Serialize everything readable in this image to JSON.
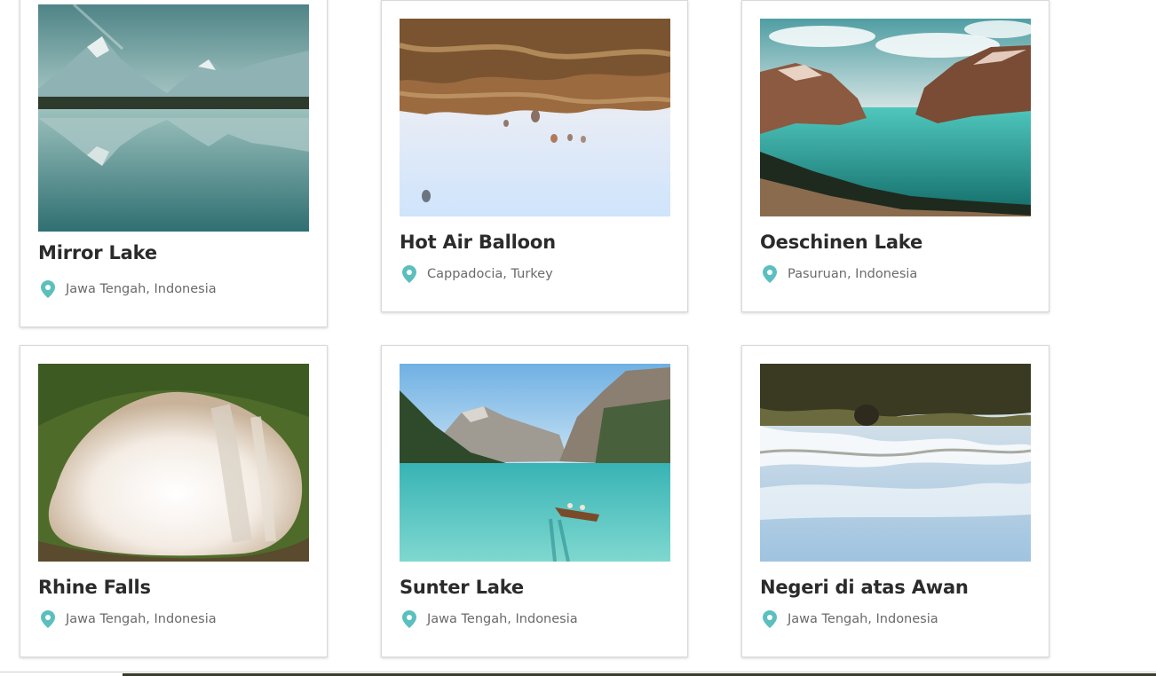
{
  "theme": {
    "pin_color": "#5bbfbf",
    "title_color": "#2b2b2b",
    "location_color": "#6a6a6a",
    "card_border": "#d9d9d9"
  },
  "cards": [
    {
      "title": "Mirror Lake",
      "location": "Jawa Tengah, Indonesia",
      "pin_icon": "map-pin-icon",
      "photo": "mountain-lake-reflection"
    },
    {
      "title": "Hot Air Balloon",
      "location": "Cappadocia, Turkey",
      "pin_icon": "map-pin-icon",
      "photo": "hot-air-balloons-inverted"
    },
    {
      "title": "Oeschinen Lake",
      "location": "Pasuruan, Indonesia",
      "pin_icon": "map-pin-icon",
      "photo": "turquoise-alpine-lake"
    },
    {
      "title": "Rhine Falls",
      "location": "Jawa Tengah, Indonesia",
      "pin_icon": "map-pin-icon",
      "photo": "waterfall-inverted"
    },
    {
      "title": "Sunter Lake",
      "location": "Jawa Tengah, Indonesia",
      "pin_icon": "map-pin-icon",
      "photo": "boat-on-turquoise-lake"
    },
    {
      "title": "Negeri di atas Awan",
      "location": "Jawa Tengah, Indonesia",
      "pin_icon": "map-pin-icon",
      "photo": "sea-of-clouds-inverted"
    }
  ]
}
